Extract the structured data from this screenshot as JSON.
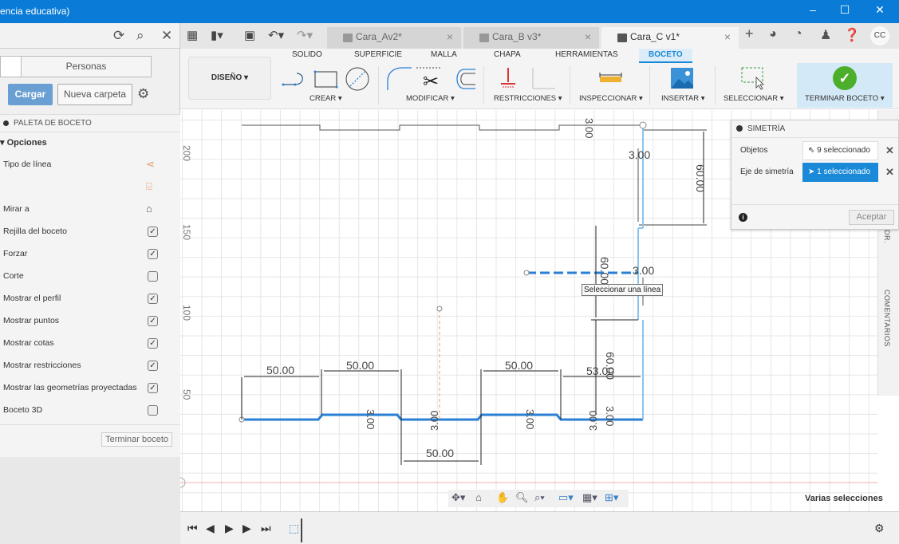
{
  "window": {
    "title": "encia educativa)",
    "controls": {
      "minimize": "–",
      "maximize": "☐",
      "close": "✕"
    }
  },
  "left_panel": {
    "tab": "Personas",
    "upload_button": "Cargar",
    "new_folder_button": "Nueva carpeta",
    "palette_title": "PALETA DE BOCETO",
    "options_title": "▾ Opciones",
    "options": [
      {
        "label": "Tipo de línea",
        "type": "icon",
        "icon": "construction-line-icon"
      },
      {
        "label": "",
        "type": "icon",
        "icon": "centerline-icon"
      },
      {
        "label": "Mirar a",
        "type": "icon",
        "icon": "look-at-icon"
      },
      {
        "label": "Rejilla del boceto",
        "type": "checkbox",
        "checked": true
      },
      {
        "label": "Forzar",
        "type": "checkbox",
        "checked": true
      },
      {
        "label": "Corte",
        "type": "checkbox",
        "checked": false
      },
      {
        "label": "Mostrar el perfil",
        "type": "checkbox",
        "checked": true
      },
      {
        "label": "Mostrar puntos",
        "type": "checkbox",
        "checked": true
      },
      {
        "label": "Mostrar cotas",
        "type": "checkbox",
        "checked": true
      },
      {
        "label": "Mostrar restricciones",
        "type": "checkbox",
        "checked": true
      },
      {
        "label": "Mostrar las geometrías proyectadas",
        "type": "checkbox",
        "checked": true
      },
      {
        "label": "Boceto 3D",
        "type": "checkbox",
        "checked": false
      }
    ],
    "finish_sketch_button": "Terminar boceto"
  },
  "doc_tabs": [
    {
      "label": "Cara_Av2*",
      "active": false
    },
    {
      "label": "Cara_B v3*",
      "active": false
    },
    {
      "label": "Cara_C v1*",
      "active": true
    }
  ],
  "user_initials": "CC",
  "ribbon": {
    "workspace": "DISEÑO ▾",
    "tabs": [
      "SOLIDO",
      "SUPERFICIE",
      "MALLA",
      "CHAPA",
      "HERRAMIENTAS",
      "BOCETO"
    ],
    "active_tab": "BOCETO",
    "groups": [
      "CREAR ▾",
      "MODIFICAR ▾",
      "RESTRICCIONES ▾",
      "INSPECCIONAR ▾",
      "INSERTAR ▾",
      "SELECCIONAR ▾",
      "TERMINAR BOCETO ▾"
    ]
  },
  "canvas": {
    "axis_labels": [
      "200",
      "150",
      "100",
      "50"
    ],
    "dimensions": {
      "d50a": "50.00",
      "d50b": "50.00",
      "d50c": "50.00",
      "d50d": "50.00",
      "d53": "53.00",
      "d60a": "60.00",
      "d60b": "60.00",
      "d60c": "60.00",
      "d3a": "3.00",
      "d3b": "3.00",
      "d3c": "3.00",
      "d3d": "3.00",
      "d3e": "3.00",
      "d3f": "3.00",
      "d3g": "3.00",
      "d3h": "3.00"
    },
    "tooltip": "Seleccionar una línea"
  },
  "dialog": {
    "title": "SIMETRÍA",
    "rows": [
      {
        "label": "Objetos",
        "value": "9 seleccionado",
        "active": false
      },
      {
        "label": "Eje de simetría",
        "value": "1 seleccionado",
        "active": true
      }
    ],
    "ok_button": "Aceptar"
  },
  "right_strip": {
    "labels": [
      "DR.",
      "COMENTARIOS"
    ]
  },
  "status": {
    "selection": "Varias selecciones"
  },
  "colors": {
    "accent": "#1a8ad8",
    "titlebar": "#0a7bd6",
    "sketch_line": "#2a7fd4",
    "ok_green": "#4caf2b",
    "upload_btn": "#6a9fd3"
  }
}
